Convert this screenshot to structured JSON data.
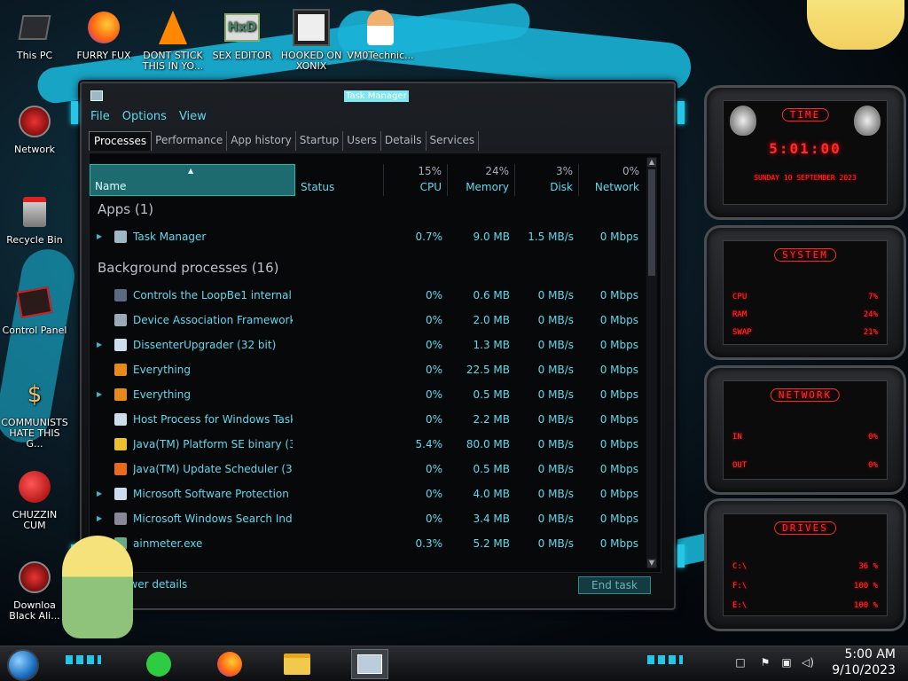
{
  "desktop": {
    "icons": [
      {
        "label": "This PC"
      },
      {
        "label": "Network"
      },
      {
        "label": "Recycle Bin"
      },
      {
        "label": "Control Panel"
      },
      {
        "label": "COMMUNISTS HATE THIS G..."
      },
      {
        "label": "CHUZZIN CUM"
      },
      {
        "label": "Downloa Black Ali..."
      },
      {
        "label": "FURRY FUX"
      },
      {
        "label": "DONT STICK THIS IN YO..."
      },
      {
        "label": "SEX EDITOR"
      },
      {
        "label": "HOOKED ON XONIX"
      },
      {
        "label": "VM0Technic..."
      }
    ]
  },
  "task_manager": {
    "title": "Task Manager",
    "menu": [
      "File",
      "Options",
      "View"
    ],
    "tabs": [
      "Processes",
      "Performance",
      "App history",
      "Startup",
      "Users",
      "Details",
      "Services"
    ],
    "active_tab": "Processes",
    "columns": {
      "name": "Name",
      "status": "Status",
      "cpu": {
        "pct": "15%",
        "label": "CPU"
      },
      "memory": {
        "pct": "24%",
        "label": "Memory"
      },
      "disk": {
        "pct": "3%",
        "label": "Disk"
      },
      "network": {
        "pct": "0%",
        "label": "Network"
      }
    },
    "groups": {
      "apps": "Apps (1)",
      "background": "Background processes (16)"
    },
    "apps": [
      {
        "name": "Task Manager",
        "cpu": "0.7%",
        "memory": "9.0 MB",
        "disk": "1.5 MB/s",
        "network": "0 Mbps"
      }
    ],
    "background": [
      {
        "name": "Controls the LoopBe1 internal ...",
        "cpu": "0%",
        "memory": "0.6 MB",
        "disk": "0 MB/s",
        "network": "0 Mbps"
      },
      {
        "name": "Device Association Framework ...",
        "cpu": "0%",
        "memory": "2.0 MB",
        "disk": "0 MB/s",
        "network": "0 Mbps"
      },
      {
        "name": "DissenterUpgrader (32 bit)",
        "cpu": "0%",
        "memory": "1.3 MB",
        "disk": "0 MB/s",
        "network": "0 Mbps"
      },
      {
        "name": "Everything",
        "cpu": "0%",
        "memory": "22.5 MB",
        "disk": "0 MB/s",
        "network": "0 Mbps"
      },
      {
        "name": "Everything",
        "cpu": "0%",
        "memory": "0.5 MB",
        "disk": "0 MB/s",
        "network": "0 Mbps"
      },
      {
        "name": "Host Process for Windows Tasks",
        "cpu": "0%",
        "memory": "2.2 MB",
        "disk": "0 MB/s",
        "network": "0 Mbps"
      },
      {
        "name": "Java(TM) Platform SE binary (32...",
        "cpu": "5.4%",
        "memory": "80.0 MB",
        "disk": "0 MB/s",
        "network": "0 Mbps"
      },
      {
        "name": "Java(TM) Update Scheduler (32 ...",
        "cpu": "0%",
        "memory": "0.5 MB",
        "disk": "0 MB/s",
        "network": "0 Mbps"
      },
      {
        "name": "Microsoft Software Protection P...",
        "cpu": "0%",
        "memory": "4.0 MB",
        "disk": "0 MB/s",
        "network": "0 Mbps"
      },
      {
        "name": "Microsoft Windows Search Inde...",
        "cpu": "0%",
        "memory": "3.4 MB",
        "disk": "0 MB/s",
        "network": "0 Mbps"
      },
      {
        "name": "ainmeter.exe",
        "cpu": "0.3%",
        "memory": "5.2 MB",
        "disk": "0 MB/s",
        "network": "0 Mbps"
      }
    ],
    "fewer_details": "ewer details",
    "end_task": "End task"
  },
  "gadgets": {
    "time": {
      "title": "TIME",
      "clock": "5:01:00",
      "date": "SUNDAY 10 SEPTEMBER 2023"
    },
    "system": {
      "title": "SYSTEM",
      "rows": [
        {
          "label": "CPU",
          "value": "7%"
        },
        {
          "label": "RAM",
          "value": "24%"
        },
        {
          "label": "SWAP",
          "value": "21%"
        }
      ]
    },
    "network": {
      "title": "NETWORK",
      "rows": [
        {
          "label": "IN",
          "value": "0%"
        },
        {
          "label": "OUT",
          "value": "0%"
        }
      ]
    },
    "drives": {
      "title": "DRIVES",
      "rows": [
        {
          "label": "C:\\",
          "value": "36 %"
        },
        {
          "label": "F:\\",
          "value": "100 %"
        },
        {
          "label": "E:\\",
          "value": "100 %"
        }
      ]
    }
  },
  "taskbar": {
    "time": "5:00 AM",
    "date": "9/10/2023"
  },
  "colors": {
    "accent": "#27c6e6",
    "text_cyan": "#62d8ec",
    "gadget_red": "#ff2a2a"
  }
}
